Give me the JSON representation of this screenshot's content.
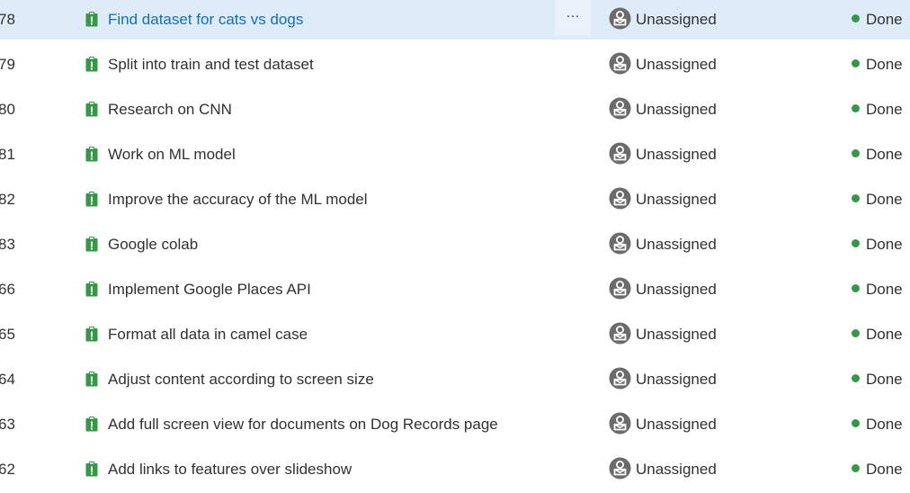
{
  "colors": {
    "selected_row_bg": "#deecf9",
    "selected_title": "#106ebe",
    "text": "#323130",
    "task_icon": "#339947",
    "done_dot": "#339947",
    "avatar": "#6b6b6b"
  },
  "more_button_label": "···",
  "rows": [
    {
      "id": "78",
      "title": "Find dataset for cats vs dogs",
      "assignee": "Unassigned",
      "state": "Done",
      "type_icon": "task-icon",
      "selected": true
    },
    {
      "id": "79",
      "title": "Split into train and test dataset",
      "assignee": "Unassigned",
      "state": "Done",
      "type_icon": "task-icon"
    },
    {
      "id": "80",
      "title": "Research on CNN",
      "assignee": "Unassigned",
      "state": "Done",
      "type_icon": "task-icon"
    },
    {
      "id": "81",
      "title": "Work on ML model",
      "assignee": "Unassigned",
      "state": "Done",
      "type_icon": "task-icon"
    },
    {
      "id": "82",
      "title": "Improve the accuracy of the ML model",
      "assignee": "Unassigned",
      "state": "Done",
      "type_icon": "task-icon"
    },
    {
      "id": "83",
      "title": "Google colab",
      "assignee": "Unassigned",
      "state": "Done",
      "type_icon": "task-icon"
    },
    {
      "id": "66",
      "title": "Implement Google Places API",
      "assignee": "Unassigned",
      "state": "Done",
      "type_icon": "task-icon"
    },
    {
      "id": "65",
      "title": "Format all data in camel case",
      "assignee": "Unassigned",
      "state": "Done",
      "type_icon": "task-icon"
    },
    {
      "id": "64",
      "title": "Adjust content according to screen size",
      "assignee": "Unassigned",
      "state": "Done",
      "type_icon": "task-icon"
    },
    {
      "id": "63",
      "title": "Add full screen view for documents on Dog Records page",
      "assignee": "Unassigned",
      "state": "Done",
      "type_icon": "task-icon"
    },
    {
      "id": "62",
      "title": "Add links to features over slideshow",
      "assignee": "Unassigned",
      "state": "Done",
      "type_icon": "task-icon"
    }
  ]
}
